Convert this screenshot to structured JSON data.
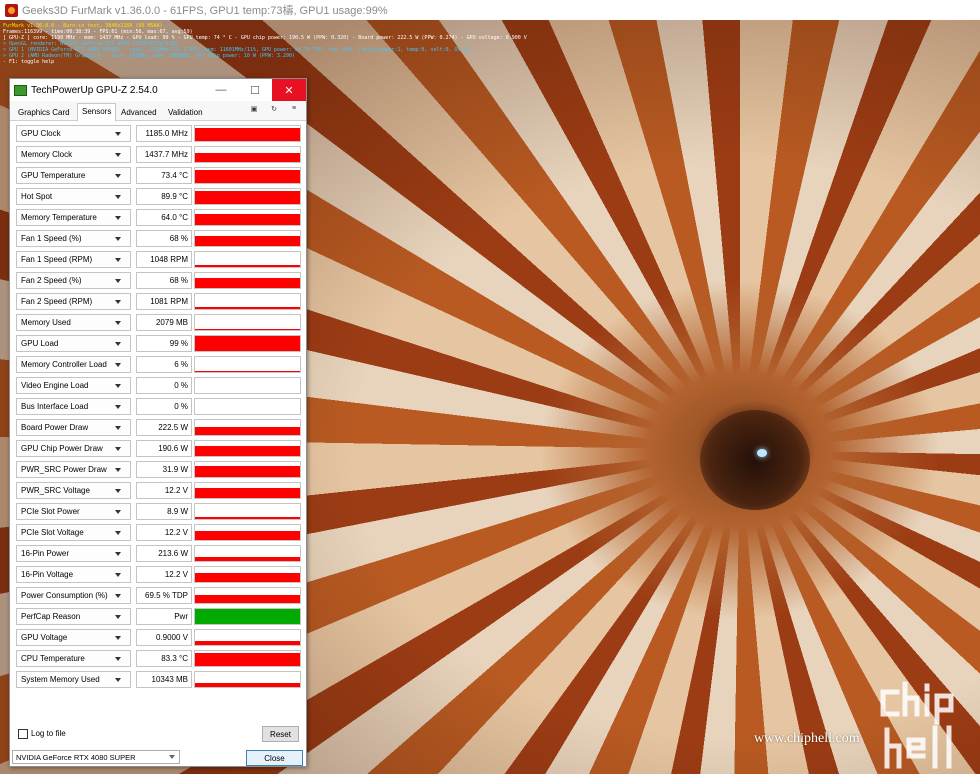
{
  "furmark": {
    "window_title": "Geeks3D FurMark v1.36.0.0 - 61FPS, GPU1 temp:73檮, GPU1 usage:99%",
    "overlay_lines": [
      {
        "text": "FurMark v1.36.0.0 - Burn-in test, 3840x2160 (0X MSAA)",
        "color": "#ffe000"
      },
      {
        "text": "Frames:116399 - time:00:38:39 - FPS:61 (min:56, max:67, avg:59)",
        "color": "#ffffff"
      },
      {
        "text": "[ GPU-Z ] core: 1190 MHz - mem: 1437 MHz - GPU load: 99 % - GPU temp: 74 ° C - GPU chip power: 190.5 W (PPW: 0.320) - Board power: 222.5 W (PPW: 0.274) - GPU voltage: 0.900 V",
        "color": "#ffffff"
      },
      {
        "text": "> OpenGL renderer: NVIDIA GeForce RTX 4080 SUPER/PCIe/SSE2",
        "color": "#3fc8ff"
      },
      {
        "text": "> GPU 1 (NVIDIA GeForce RTX 4080 SUPER) - core: 1215MHz/73° C/99%, mem: 11601MHz/11%, GPU power: 84.7% TDP, fan: 68%, limits[power:1, temp:0, volt:0, OV:0]",
        "color": "#3fc8ff"
      },
      {
        "text": "> GPU 2 (AMD Radeon(TM) Graphics) - core: 600MHz, mem: 2000MHz, GPU chip power: 10 W (PPW: 3.290)",
        "color": "#3fc8ff"
      },
      {
        "text": "- F1: toggle help",
        "color": "#ffffff"
      }
    ]
  },
  "watermark": {
    "url": "www.chiphell.com",
    "logo": "chip hell"
  },
  "gpuz": {
    "title": "TechPowerUp GPU-Z 2.54.0",
    "tabs": [
      "Graphics Card",
      "Sensors",
      "Advanced",
      "Validation"
    ],
    "active_tab": "Sensors",
    "toolbar_icons": [
      "camera-icon",
      "refresh-icon",
      "menu-icon"
    ],
    "sensors": [
      {
        "name": "GPU Clock",
        "value": "1185.0 MHz",
        "graph_level": 0.9,
        "color": "#ff0000"
      },
      {
        "name": "Memory Clock",
        "value": "1437.7 MHz",
        "graph_level": 0.6,
        "color": "#ff0000"
      },
      {
        "name": "GPU Temperature",
        "value": "73.4 °C",
        "graph_level": 0.85,
        "color": "#ff0000"
      },
      {
        "name": "Hot Spot",
        "value": "89.9 °C",
        "graph_level": 0.9,
        "color": "#ff0000"
      },
      {
        "name": "Memory Temperature",
        "value": "64.0 °C",
        "graph_level": 0.75,
        "color": "#ff0000"
      },
      {
        "name": "Fan 1 Speed (%)",
        "value": "68 %",
        "graph_level": 0.7,
        "color": "#ff0000"
      },
      {
        "name": "Fan 1 Speed (RPM)",
        "value": "1048 RPM",
        "graph_level": 0.15,
        "color": "#ff0000"
      },
      {
        "name": "Fan 2 Speed (%)",
        "value": "68 %",
        "graph_level": 0.7,
        "color": "#ff0000"
      },
      {
        "name": "Fan 2 Speed (RPM)",
        "value": "1081 RPM",
        "graph_level": 0.15,
        "color": "#ff0000"
      },
      {
        "name": "Memory Used",
        "value": "2079 MB",
        "graph_level": 0.1,
        "color": "#ff0000"
      },
      {
        "name": "GPU Load",
        "value": "99 %",
        "graph_level": 0.99,
        "color": "#ff0000"
      },
      {
        "name": "Memory Controller Load",
        "value": "6 %",
        "graph_level": 0.06,
        "color": "#ff0000"
      },
      {
        "name": "Video Engine Load",
        "value": "0 %",
        "graph_level": 0.0,
        "color": "#ff0000"
      },
      {
        "name": "Bus Interface Load",
        "value": "0 %",
        "graph_level": 0.0,
        "color": "#ff0000"
      },
      {
        "name": "Board Power Draw",
        "value": "222.5 W",
        "graph_level": 0.55,
        "color": "#ff0000"
      },
      {
        "name": "GPU Chip Power Draw",
        "value": "190.6 W",
        "graph_level": 0.7,
        "color": "#ff0000"
      },
      {
        "name": "PWR_SRC Power Draw",
        "value": "31.9 W",
        "graph_level": 0.75,
        "color": "#ff0000"
      },
      {
        "name": "PWR_SRC Voltage",
        "value": "12.2 V",
        "graph_level": 0.65,
        "color": "#ff0000"
      },
      {
        "name": "PCIe Slot Power",
        "value": "8.9 W",
        "graph_level": 0.12,
        "color": "#ff0000"
      },
      {
        "name": "PCIe Slot Voltage",
        "value": "12.2 V",
        "graph_level": 0.6,
        "color": "#ff0000"
      },
      {
        "name": "16-Pin Power",
        "value": "213.6 W",
        "graph_level": 0.3,
        "color": "#ff0000"
      },
      {
        "name": "16-Pin Voltage",
        "value": "12.2 V",
        "graph_level": 0.6,
        "color": "#ff0000"
      },
      {
        "name": "Power Consumption (%)",
        "value": "69.5 % TDP",
        "graph_level": 0.55,
        "color": "#ff0000"
      },
      {
        "name": "PerfCap Reason",
        "value": "Pwr",
        "graph_level": 1.0,
        "color": "#00aa00"
      },
      {
        "name": "GPU Voltage",
        "value": "0.9000 V",
        "graph_level": 0.3,
        "color": "#ff0000"
      },
      {
        "name": "CPU Temperature",
        "value": "83.3 °C",
        "graph_level": 0.85,
        "color": "#ff0000"
      },
      {
        "name": "System Memory Used",
        "value": "10343 MB",
        "graph_level": 0.25,
        "color": "#ff0000"
      }
    ],
    "log_to_file_label": "Log to file",
    "log_to_file_checked": false,
    "reset_label": "Reset",
    "gpu_selected": "NVIDIA GeForce RTX 4080 SUPER",
    "close_label": "Close"
  }
}
